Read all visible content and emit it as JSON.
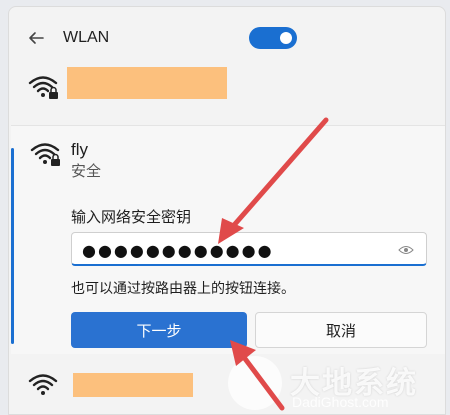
{
  "header": {
    "title": "WLAN",
    "toggle_on": true
  },
  "networks": [
    {
      "name_redacted": true,
      "secured": true
    },
    {
      "name": "fly",
      "status": "安全",
      "password_label": "输入网络安全密钥",
      "password_value": "●●●●●●●●●●●●",
      "hint": "也可以通过按路由器上的按钮连接。",
      "next_label": "下一步",
      "cancel_label": "取消"
    },
    {
      "name_redacted": true,
      "secured": false
    }
  ],
  "watermark": {
    "text": "大地系统",
    "url": "DadiGhost.com"
  },
  "colors": {
    "accent": "#2a72d1",
    "redact": "#fcc07d",
    "arrow": "#e04a4a"
  }
}
